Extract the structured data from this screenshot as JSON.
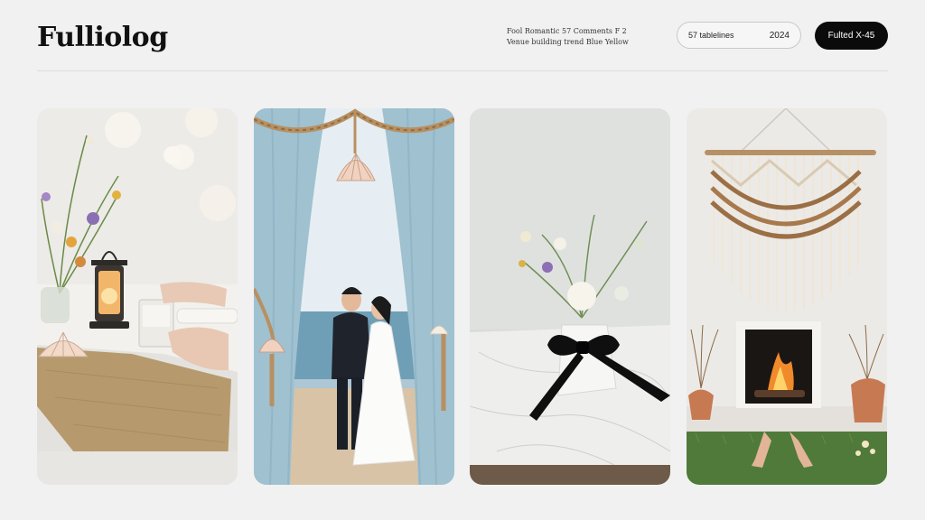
{
  "brand": {
    "logo": "Fulliolog"
  },
  "header_meta": {
    "line1": "Fool Romantic 57 Comments   F   2",
    "line2": "Venue   building   trend   Blue   Yellow"
  },
  "search": {
    "value": "57 tablelines",
    "year": "2024"
  },
  "cta": {
    "label": "Fulted X-45"
  },
  "gallery": [
    {
      "name": "beach-table-scene",
      "icon": "lantern-icon"
    },
    {
      "name": "sheer-curtain-arch-couple",
      "icon": "seashell-icon"
    },
    {
      "name": "ribbon-vase-marble",
      "icon": "ribbon-icon"
    },
    {
      "name": "macrame-fireplace",
      "icon": "fireplace-icon"
    }
  ],
  "colors": {
    "background": "#f1f1f2",
    "button": "#0b0b0b",
    "curtain": "#a9c7d4",
    "rope": "#b89060",
    "burlap": "#b69a6d"
  }
}
